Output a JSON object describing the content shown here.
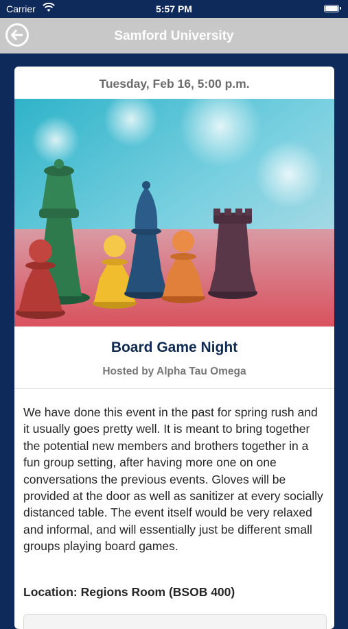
{
  "status_bar": {
    "carrier": "Carrier",
    "time": "5:57 PM"
  },
  "nav": {
    "title": "Samford University",
    "back_icon": "back-arrow-icon"
  },
  "event": {
    "date": "Tuesday, Feb 16, 5:00 p.m.",
    "image_description_icon": "chess-pieces-image",
    "title": "Board Game Night",
    "host": "Hosted by Alpha Tau Omega",
    "description": "We have done this event in the past for spring rush and it usually goes pretty well. It is meant to bring together the potential new members and brothers together in a fun group setting, after having more one on one conversations the previous events. Gloves will be provided at the door as well as sanitizer at every socially distanced table. The event itself would be very relaxed and informal, and will essentially just be different small groups playing board games.",
    "location": "Location: Regions Room (BSOB 400)"
  },
  "colors": {
    "background": "#0e2a5a",
    "nav_bar": "#c8c8c8",
    "title_navy": "#0f2a52"
  }
}
